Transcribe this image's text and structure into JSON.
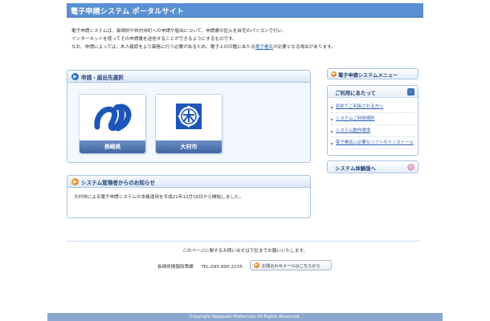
{
  "header": {
    "title": "電子申請システム ポータルサイト"
  },
  "intro": {
    "line1": "電子申請システムは、長崎県や県内市町への申請や届出について、申請書の記入を自宅のパソコンで行い、",
    "line2": "インターネットを使ってその申請書を送信することができるようにするものです。",
    "line3_pre": "なお、申請によっては、本人確認をより厳格に行う必要があるため、電子上の印鑑にあたる",
    "line3_link": "電子署名",
    "line3_post": "が必要となる場合があります。"
  },
  "apply": {
    "title": "申請・届出先選択",
    "tiles": [
      {
        "label": "長崎県",
        "icon": "nagasaki-prefecture-emblem"
      },
      {
        "label": "大村市",
        "icon": "omura-city-emblem"
      }
    ]
  },
  "notice": {
    "title": "システム管理者からのお知らせ",
    "body": "大村市による電子申請システムの本格運用を平成21年12月16日から開始しました。"
  },
  "menu": {
    "title": "電子申請システムメニュー",
    "section_title": "ご利用にあたって",
    "links": [
      "初めてご利用される方へ",
      "システムご利用規約",
      "システム動作環境",
      "電子署名に必要なソフトのインストール"
    ],
    "trial_label": "システム体験版へ"
  },
  "contact": {
    "line": "このページに関するお問い合せは下記までお願いいたします。",
    "org": "長崎県情報政策課",
    "tel": "TEL:095-895-2235",
    "button_label": "お問合わせメールはこちらから"
  },
  "footer": {
    "copyright": "Copyright Nagasaki Prefecture All Rights Reserved."
  },
  "colors": {
    "header": "#5a8fd2",
    "link": "#2a5db0",
    "panel_border": "#a9c3e6",
    "footer": "#8aa7cf"
  }
}
